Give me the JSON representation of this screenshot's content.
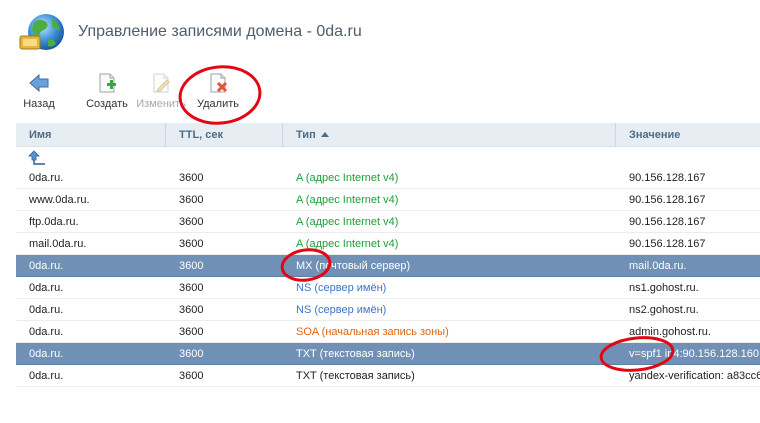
{
  "page": {
    "title": "Управление записями домена - 0da.ru"
  },
  "toolbar": {
    "buttons": [
      {
        "label": "Назад",
        "icon": "back-arrow-icon",
        "enabled": true
      },
      {
        "label": "Создать",
        "icon": "new-document-icon",
        "enabled": true
      },
      {
        "label": "Изменить",
        "icon": "edit-document-icon",
        "enabled": false
      },
      {
        "label": "Удалить",
        "icon": "delete-document-icon",
        "enabled": true
      }
    ]
  },
  "table": {
    "columns": [
      "Имя",
      "TTL, сек",
      "Тип",
      "Значение"
    ],
    "sorted_column": "Тип",
    "sort_direction": "ascending",
    "rows": [
      {
        "name": "0da.ru.",
        "ttl": "3600",
        "type": "A (адрес Internet v4)",
        "value": "90.156.128.167",
        "selected": false
      },
      {
        "name": "www.0da.ru.",
        "ttl": "3600",
        "type": "A (адрес Internet v4)",
        "value": "90.156.128.167",
        "selected": false
      },
      {
        "name": "ftp.0da.ru.",
        "ttl": "3600",
        "type": "A (адрес Internet v4)",
        "value": "90.156.128.167",
        "selected": false
      },
      {
        "name": "mail.0da.ru.",
        "ttl": "3600",
        "type": "A (адрес Internet v4)",
        "value": "90.156.128.167",
        "selected": false
      },
      {
        "name": "0da.ru.",
        "ttl": "3600",
        "type": "MX (почтовый сервер)",
        "value": "mail.0da.ru.",
        "selected": true
      },
      {
        "name": "0da.ru.",
        "ttl": "3600",
        "type": "NS (сервер имён)",
        "value": "ns1.gohost.ru.",
        "selected": false
      },
      {
        "name": "0da.ru.",
        "ttl": "3600",
        "type": "NS (сервер имён)",
        "value": "ns2.gohost.ru.",
        "selected": false
      },
      {
        "name": "0da.ru.",
        "ttl": "3600",
        "type": "SOA (начальная запись зоны)",
        "value": "admin.gohost.ru.",
        "selected": false
      },
      {
        "name": "0da.ru.",
        "ttl": "3600",
        "type": "TXT (текстовая запись)",
        "value": "v=spf1 ip4:90.156.128.160",
        "selected": true
      },
      {
        "name": "0da.ru.",
        "ttl": "3600",
        "type": "TXT (текстовая запись)",
        "value": "yandex-verification: a83cc6",
        "selected": false
      }
    ]
  },
  "colors": {
    "type_A": "#1f9e3a",
    "type_NS": "#3f74c6",
    "type_SOA": "#e06512",
    "type_TXT": "#222222",
    "selected_row": "#7091b5",
    "header_bg": "#e6edf3",
    "annotation": "#e30613"
  }
}
